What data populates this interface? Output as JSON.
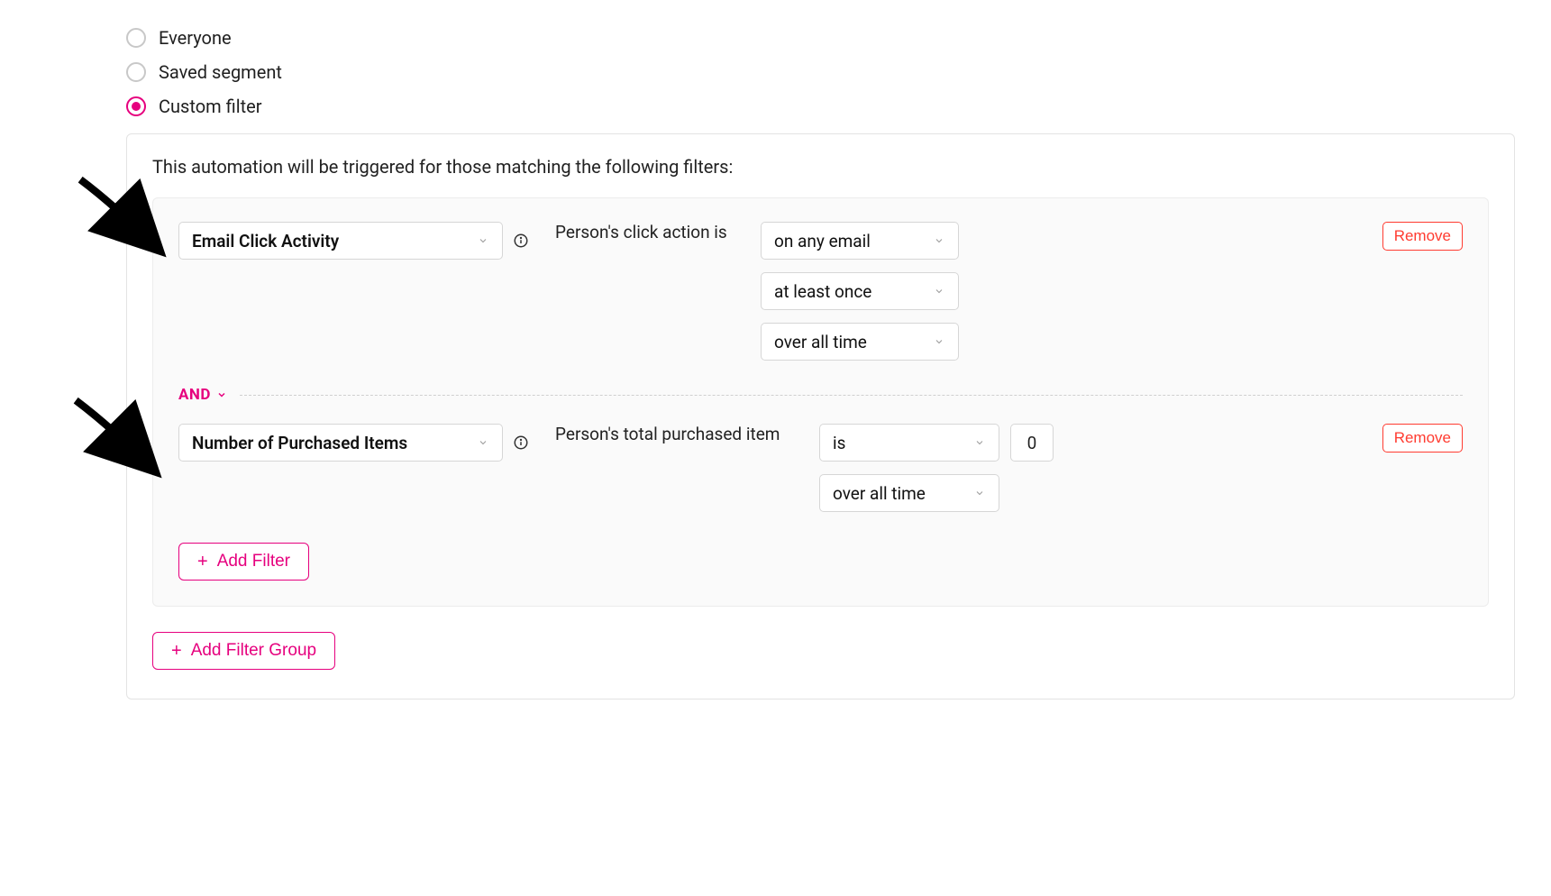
{
  "radios": {
    "everyone": "Everyone",
    "saved_segment": "Saved segment",
    "custom_filter": "Custom filter",
    "selected": "custom_filter"
  },
  "panel": {
    "intro": "This automation will be triggered for those matching the following filters:",
    "filters": [
      {
        "attribute": "Email Click Activity",
        "mid_label": "Person's click action is",
        "dropdowns": [
          "on any email",
          "at least once",
          "over all time"
        ],
        "remove": "Remove"
      },
      {
        "attribute": "Number of Purchased Items",
        "mid_label": "Person's total purchased item",
        "operator": "is",
        "value": "0",
        "dropdowns_after": [
          "over all time"
        ],
        "remove": "Remove"
      }
    ],
    "and_label": "AND",
    "add_filter": "Add Filter",
    "add_filter_group": "Add Filter Group"
  }
}
